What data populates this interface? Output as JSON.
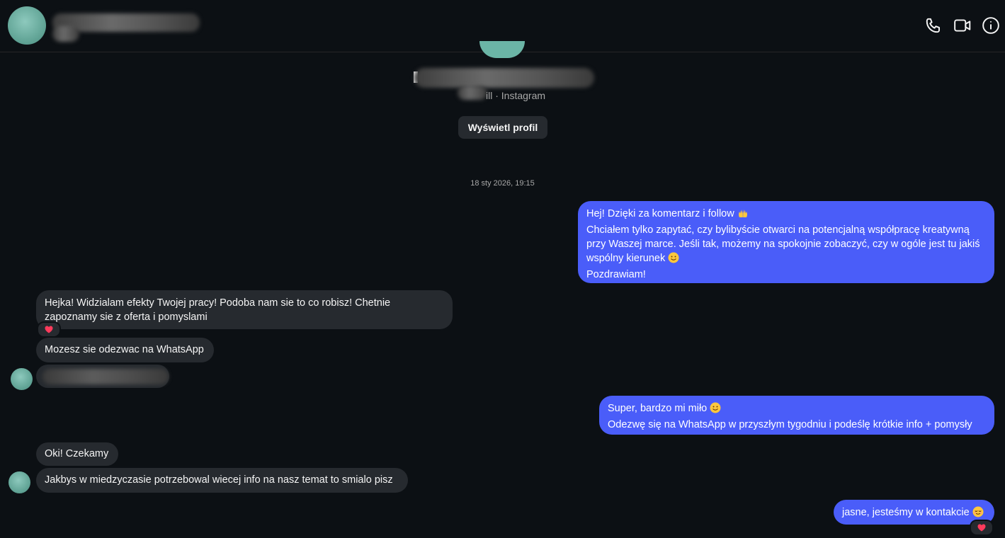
{
  "header": {
    "contact_name": "",
    "icons": [
      "phone-icon",
      "video-camera-icon",
      "info-icon"
    ]
  },
  "profile": {
    "meta": "ill · Instagram",
    "view_profile_label": "Wyświetl profil"
  },
  "conversation": {
    "timestamp": "18 sty 2026, 19:15",
    "messages": [
      {
        "direction": "outgoing",
        "text_lines": [
          "Hej! Dzięki za komentarz i follow",
          "Chciałem tylko zapytać, czy bylibyście otwarci na potencjalną współpracę kreatywną",
          "przy Waszej marce. Jeśli tak, możemy na spokojnie zobaczyć, czy w ogóle jest tu jakiś",
          "wspólny kierunek",
          "Pozdrawiam!"
        ],
        "emojis": [
          "raised-hands-emoji",
          "slightly-smiling-emoji"
        ]
      },
      {
        "direction": "incoming",
        "text_lines": [
          "Hejka! Widzialam efekty Twojej pracy! Podoba nam sie to co robisz! Chetnie",
          "zapoznamy sie z oferta i pomyslami"
        ],
        "reaction": "heart"
      },
      {
        "direction": "incoming",
        "text": "Mozesz sie odezwac na WhatsApp"
      },
      {
        "direction": "incoming",
        "text": ""
      },
      {
        "direction": "outgoing",
        "text_lines": [
          "Super, bardzo mi miło",
          "Odezwę się na WhatsApp w przyszłym tygodniu i podeślę krótkie info + pomysły"
        ],
        "emojis": [
          "slightly-smiling-emoji"
        ]
      },
      {
        "direction": "incoming",
        "text": "Oki! Czekamy"
      },
      {
        "direction": "incoming",
        "text": "Jakbys w miedzyczasie potrzebowal wiecej info na nasz temat to smialo pisz"
      },
      {
        "direction": "outgoing",
        "text": "jasne, jesteśmy w kontakcie",
        "emojis": [
          "relieved-face-emoji"
        ],
        "reaction": "heart"
      }
    ]
  },
  "colors": {
    "background": "#0c1014",
    "outgoing_bubble": "#4a5df9",
    "incoming_bubble": "#262a2f",
    "muted_text": "#a8a8a8",
    "reaction_heart": "#ff3b5c"
  }
}
